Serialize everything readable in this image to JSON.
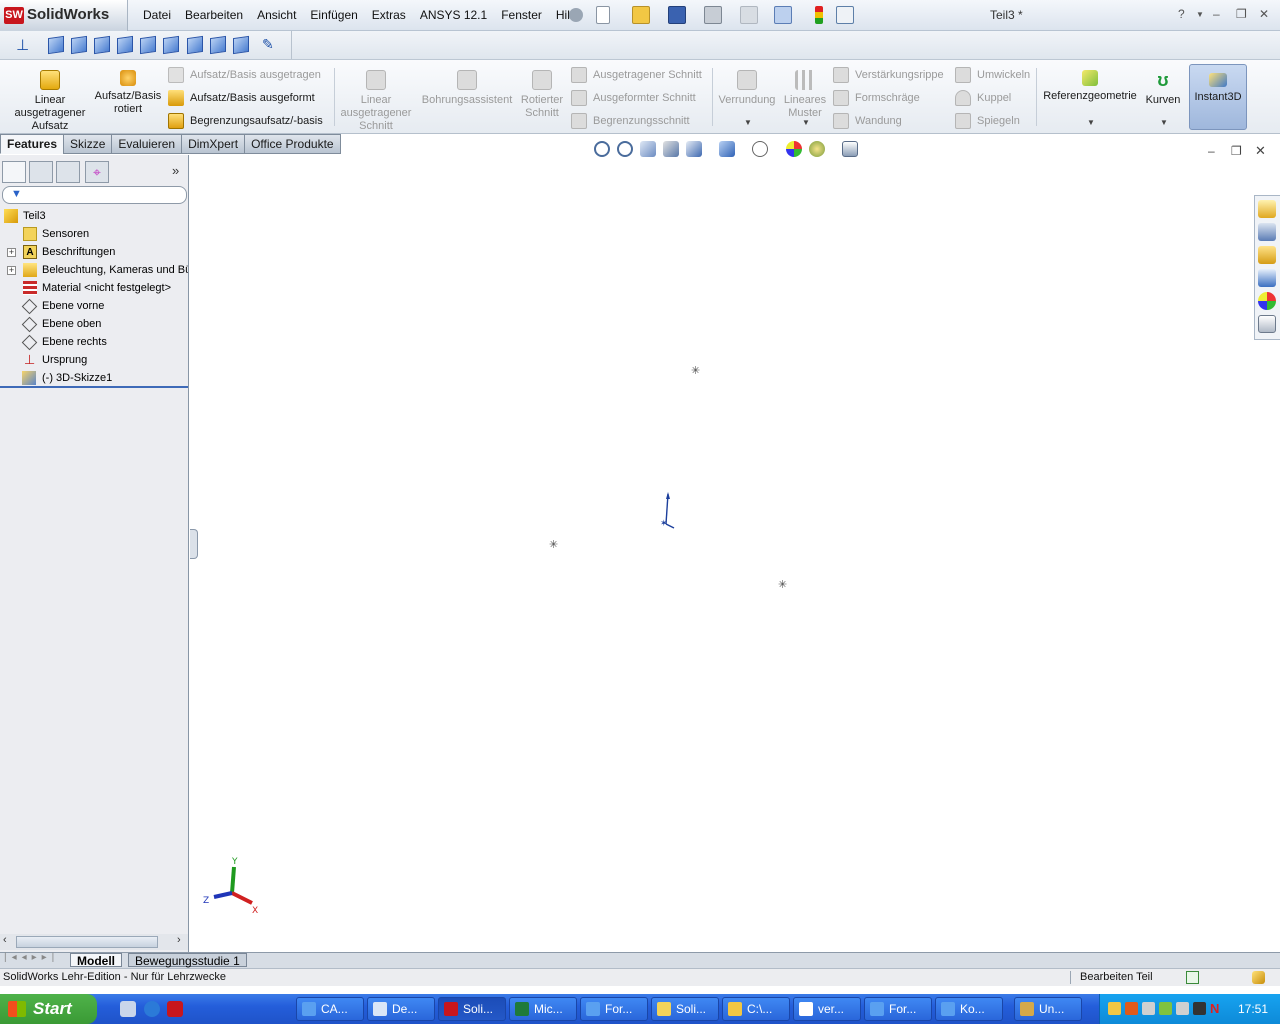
{
  "app": {
    "logo_text": "SolidWorks",
    "doc_title": "Teil3 *",
    "menu": [
      "Datei",
      "Bearbeiten",
      "Ansicht",
      "Einfügen",
      "Extras",
      "ANSYS 12.1",
      "Fenster",
      "Hilfe"
    ],
    "help_label": "?"
  },
  "command_manager": {
    "linear_aufsatz": "Linear ausgetragener Aufsatz",
    "aufsatz_rotiert": "Aufsatz/Basis rotiert",
    "aufsatz_ausgetragen": "Aufsatz/Basis ausgetragen",
    "aufsatz_ausgeformt": "Aufsatz/Basis ausgeformt",
    "begrenzungsaufsatz": "Begrenzungsaufsatz/-basis",
    "linear_schnitt": "Linear ausgetragener Schnitt",
    "bohrungsassistent": "Bohrungsassistent",
    "rotierter_schnitt": "Rotierter Schnitt",
    "ausgetragener_schnitt": "Ausgetragener Schnitt",
    "ausgeformter_schnitt": "Ausgeformter Schnitt",
    "begrenzungsschnitt": "Begrenzungsschnitt",
    "verrundung": "Verrundung",
    "lineares_muster": "Lineares Muster",
    "verstaerkungsrippe": "Verstärkungsrippe",
    "formschraege": "Formschräge",
    "wandung": "Wandung",
    "umwickeln": "Umwickeln",
    "kuppel": "Kuppel",
    "spiegeln": "Spiegeln",
    "referenzgeometrie": "Referenzgeometrie",
    "kurven": "Kurven",
    "instant3d": "Instant3D"
  },
  "tabs": [
    "Features",
    "Skizze",
    "Evaluieren",
    "DimXpert",
    "Office Produkte"
  ],
  "tree": {
    "root": "Teil3",
    "items": [
      {
        "label": "Sensoren",
        "expandable": false
      },
      {
        "label": "Beschriftungen",
        "expandable": true
      },
      {
        "label": "Beleuchtung, Kameras und Bül",
        "expandable": true
      },
      {
        "label": "Material <nicht festgelegt>",
        "expandable": false
      },
      {
        "label": "Ebene vorne",
        "expandable": false
      },
      {
        "label": "Ebene oben",
        "expandable": false
      },
      {
        "label": "Ebene rechts",
        "expandable": false
      },
      {
        "label": "Ursprung",
        "expandable": false
      },
      {
        "label": "(-) 3D-Skizze1",
        "expandable": false
      }
    ],
    "expand_symbol": "+"
  },
  "triad": {
    "x": "X",
    "y": "Y",
    "z": "Z"
  },
  "bottom_tabs": [
    "Modell",
    "Bewegungsstudie 1"
  ],
  "status": {
    "left": "SolidWorks Lehr-Edition - Nur für Lehrzwecke",
    "right": "Bearbeiten Teil"
  },
  "taskbar": {
    "start": "Start",
    "buttons": [
      "CA...",
      "De...",
      "Soli...",
      "Mic...",
      "For...",
      "Soli...",
      "C:\\...",
      "ver...",
      "For...",
      "Ko...",
      "Un..."
    ],
    "clock": "17:51"
  }
}
